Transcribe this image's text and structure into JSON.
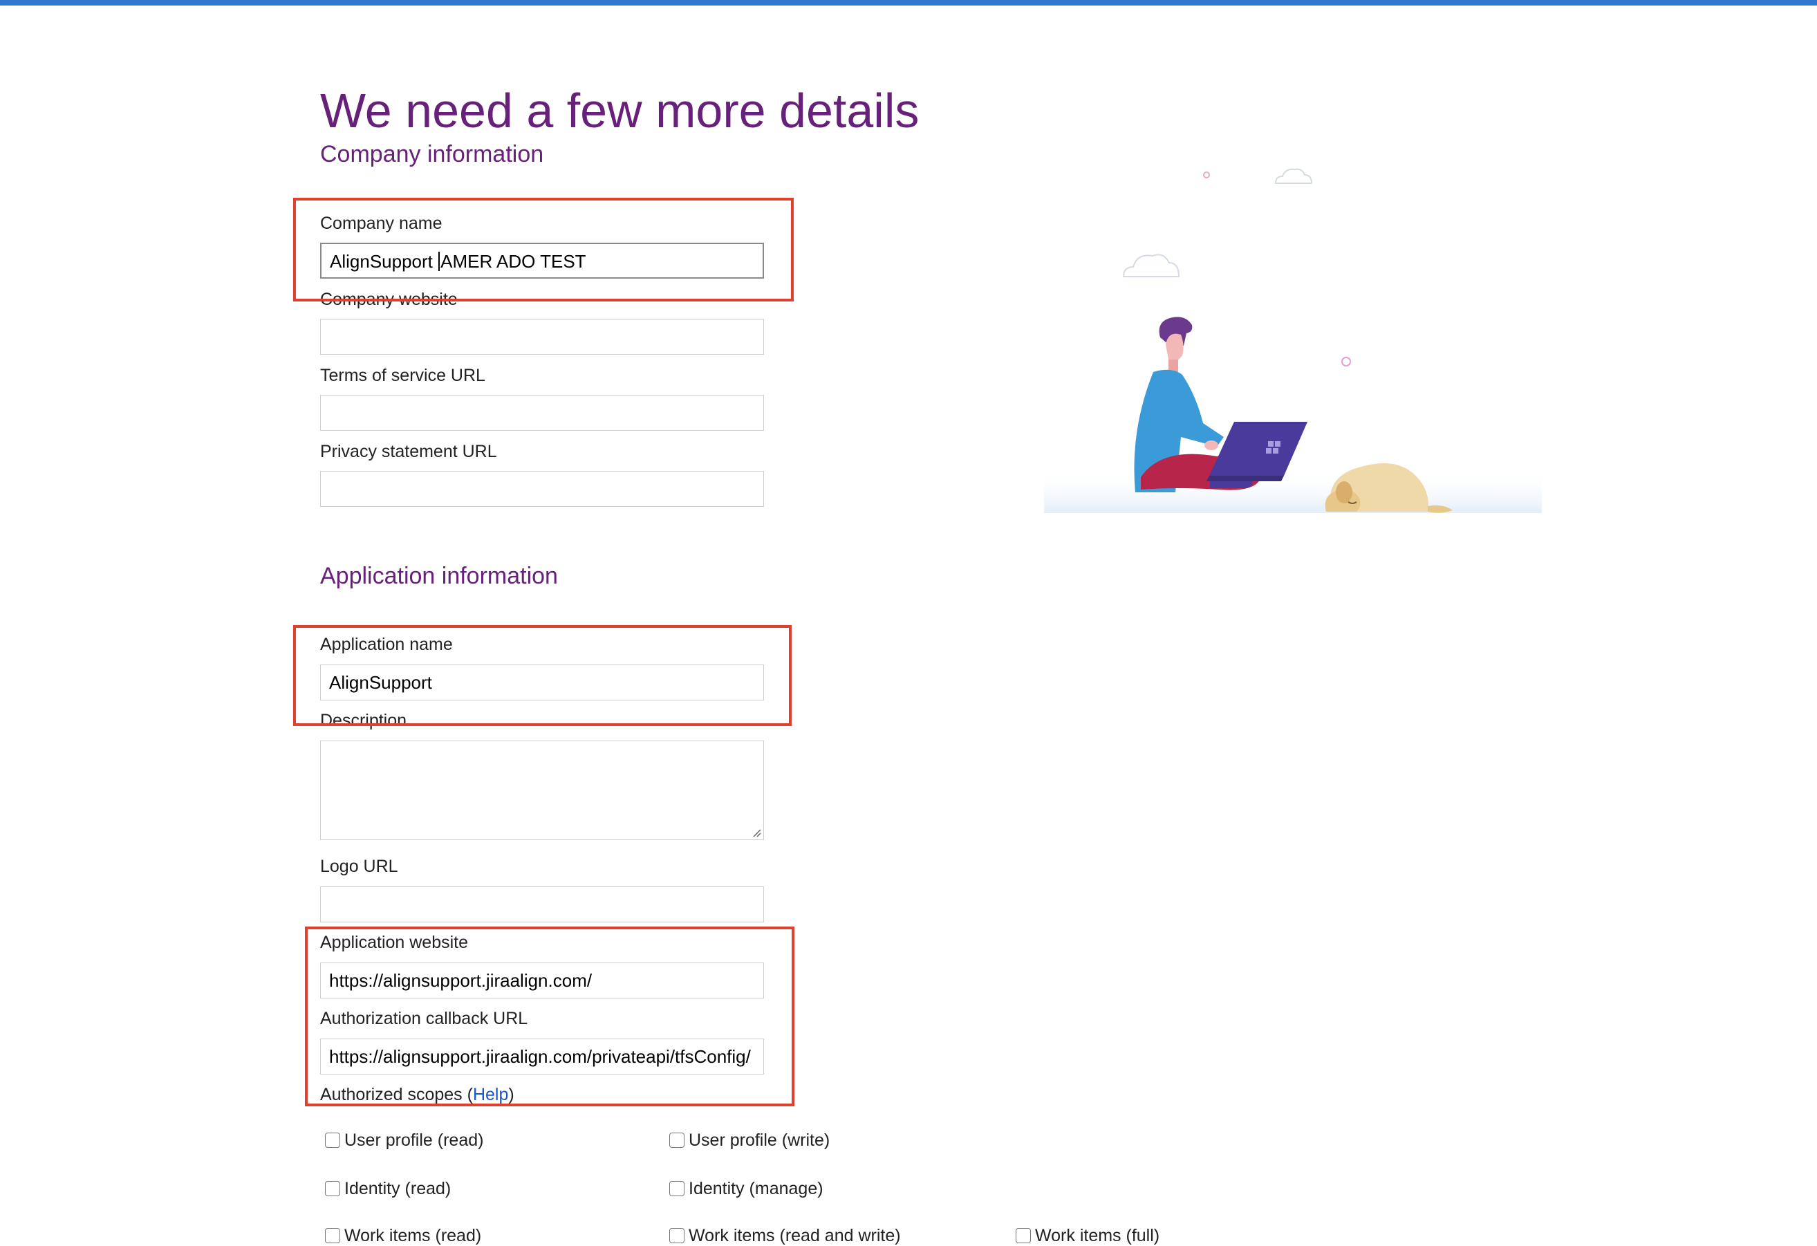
{
  "page": {
    "title": "We need a few more details",
    "accent_color": "#68217a",
    "highlight_color": "#e0412c",
    "top_bar_color": "#2f77d1"
  },
  "company": {
    "section_title": "Company information",
    "name_label": "Company name",
    "name_value_before_caret": "AlignSupport ",
    "name_value_after_caret": "AMER ADO TEST",
    "website_label": "Company website",
    "website_value": "",
    "tos_label": "Terms of service URL",
    "tos_value": "",
    "privacy_label": "Privacy statement URL",
    "privacy_value": ""
  },
  "application": {
    "section_title": "Application information",
    "name_label": "Application name",
    "name_value": "AlignSupport",
    "description_label": "Description",
    "description_value": "",
    "logo_label": "Logo URL",
    "logo_value": "",
    "website_label": "Application website",
    "website_value": "https://alignsupport.jiraalign.com/",
    "callback_label": "Authorization callback URL",
    "callback_value": "https://alignsupport.jiraalign.com/privateapi/tfsConfig/",
    "scopes_label_prefix": "Authorized scopes (",
    "scopes_help_link": "Help",
    "scopes_label_suffix": ")"
  },
  "scopes": [
    {
      "label": "User profile (read)",
      "checked": false
    },
    {
      "label": "User profile (write)",
      "checked": false
    },
    {
      "label": "Identity (read)",
      "checked": false
    },
    {
      "label": "Identity (manage)",
      "checked": false
    },
    {
      "label": "Work items (read)",
      "checked": false
    },
    {
      "label": "Work items (read and write)",
      "checked": false
    },
    {
      "label": "Work items (full)",
      "checked": false
    }
  ],
  "illustration": {
    "icons": [
      "cloud-icon",
      "person-with-laptop-icon",
      "sleeping-dog-icon"
    ]
  }
}
